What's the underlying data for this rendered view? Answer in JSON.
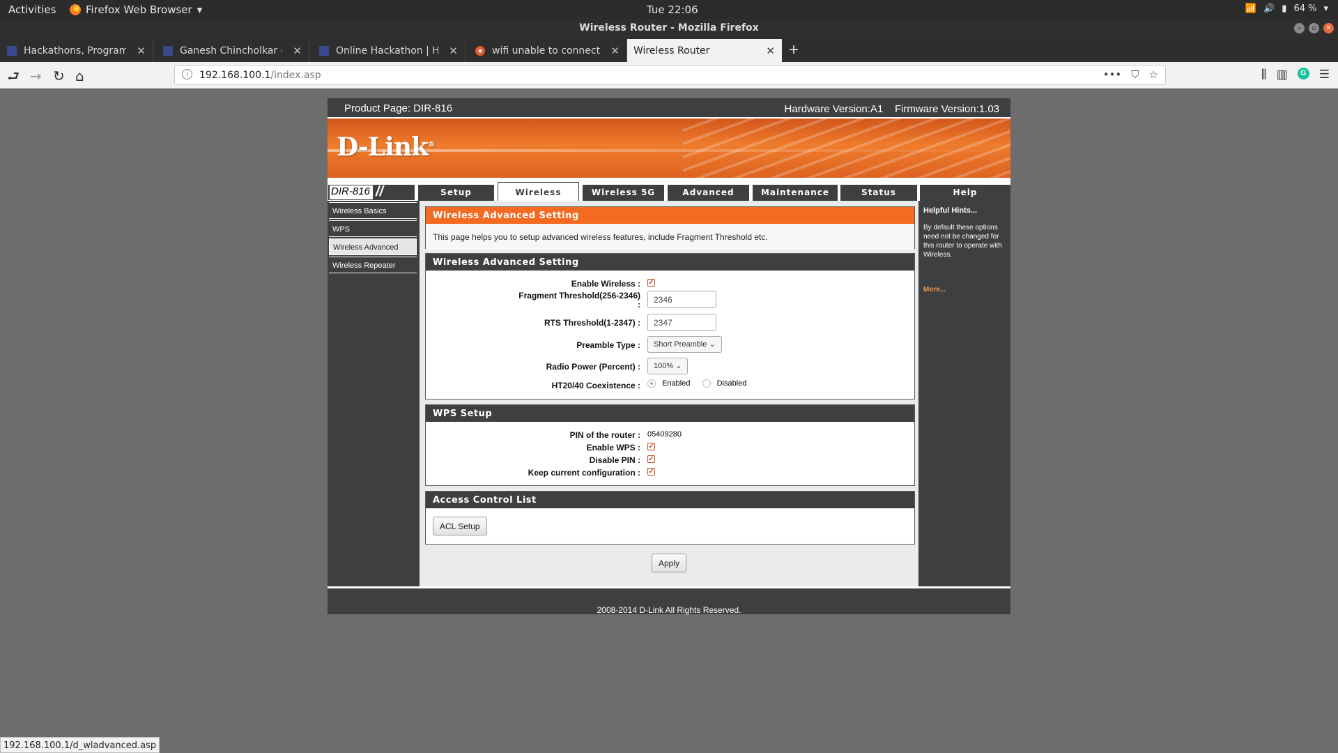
{
  "system": {
    "activities": "Activities",
    "app_name": "Firefox Web Browser",
    "clock": "Tue 22:06",
    "battery": "64 %"
  },
  "window": {
    "title": "Wireless Router - Mozilla Firefox"
  },
  "tabs": [
    {
      "label": "Hackathons, Programmi"
    },
    {
      "label": "Ganesh Chincholkar - Edi"
    },
    {
      "label": "Online Hackathon | Hack"
    },
    {
      "label": "wifi unable to connect to"
    },
    {
      "label": "Wireless Router"
    }
  ],
  "address": {
    "host": "192.168.100.1",
    "path": "/index.asp"
  },
  "router": {
    "product_page": "Product Page: DIR-816",
    "hw_fw": "Hardware Version:A1    Firmware Version:1.03",
    "logo": "D-Link",
    "model": "DIR-816",
    "nav": [
      "Setup",
      "Wireless",
      "Wireless 5G",
      "Advanced",
      "Maintenance",
      "Status",
      "Help"
    ],
    "sidebar": [
      "Wireless Basics",
      "WPS",
      "Wireless Advanced",
      "Wireless Repeater"
    ],
    "intro": {
      "title": "Wireless Advanced Setting",
      "text": "This page helps you to setup advanced wireless features, include Fragment Threshold etc."
    },
    "advanced": {
      "title": "Wireless Advanced Setting",
      "enable_wireless_label": "Enable Wireless :",
      "fragment_label_1": "Fragment Threshold(256-2346)",
      "fragment_label_2": ":",
      "fragment_value": "2346",
      "rts_label": "RTS Threshold(1-2347) :",
      "rts_value": "2347",
      "preamble_label": "Preamble Type :",
      "preamble_value": "Short Preamble",
      "radio_power_label": "Radio Power (Percent) :",
      "radio_power_value": "100%",
      "coexistence_label": "HT20/40 Coexistence :",
      "enabled_label": "Enabled",
      "disabled_label": "Disabled"
    },
    "wps": {
      "title": "WPS Setup",
      "pin_label": "PIN of the router :",
      "pin_value": "05409280",
      "enable_wps_label": "Enable WPS :",
      "disable_pin_label": "Disable PIN :",
      "keep_config_label": "Keep current configuration :"
    },
    "acl": {
      "title": "Access Control List",
      "button": "ACL Setup"
    },
    "apply": "Apply",
    "hints": {
      "title": "Helpful Hints...",
      "body": "By default these options need not be changed for this router to operate with Wireless.",
      "more": "More..."
    },
    "footer": "2008-2014 D-Link All Rights Reserved."
  },
  "status_url": "192.168.100.1/d_wladvanced.asp"
}
